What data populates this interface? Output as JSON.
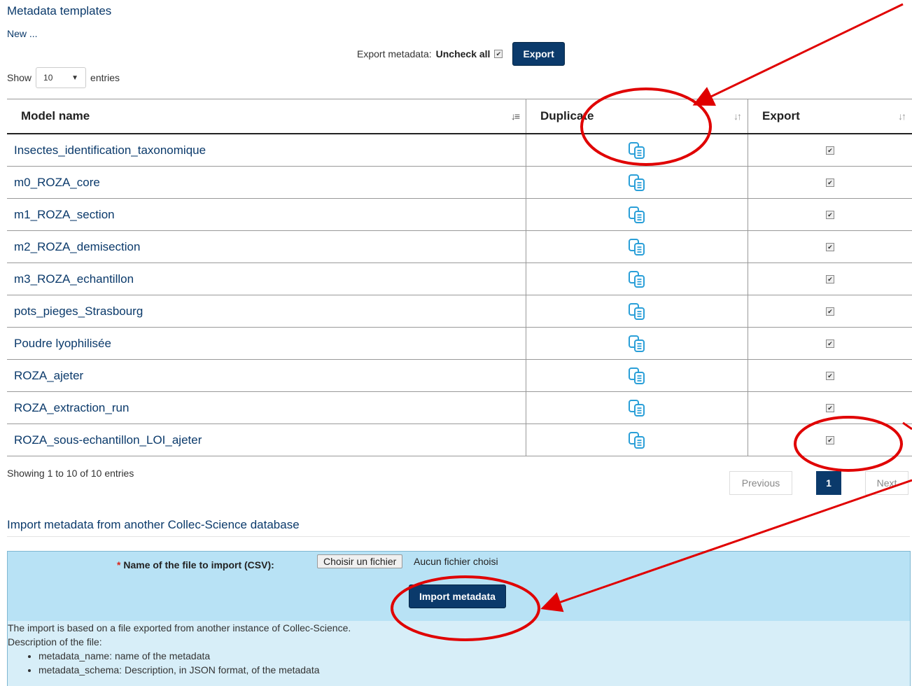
{
  "page": {
    "title": "Metadata templates",
    "new_link": "New ..."
  },
  "export_bar": {
    "label": "Export metadata:",
    "uncheck_all": "Uncheck all",
    "check_mark": "✔",
    "button": "Export"
  },
  "length_menu": {
    "show": "Show",
    "value": "10",
    "entries": "entries"
  },
  "table": {
    "headers": {
      "model_name": "Model name",
      "duplicate": "Duplicate",
      "export": "Export"
    },
    "rows": [
      {
        "name": "Insectes_identification_taxonomique",
        "checked": true
      },
      {
        "name": "m0_ROZA_core",
        "checked": true
      },
      {
        "name": "m1_ROZA_section",
        "checked": true
      },
      {
        "name": "m2_ROZA_demisection",
        "checked": true
      },
      {
        "name": "m3_ROZA_echantillon",
        "checked": true
      },
      {
        "name": "pots_pieges_Strasbourg",
        "checked": true
      },
      {
        "name": "Poudre lyophilisée",
        "checked": true
      },
      {
        "name": "ROZA_ajeter",
        "checked": true
      },
      {
        "name": "ROZA_extraction_run",
        "checked": true
      },
      {
        "name": "ROZA_sous-echantillon_LOI_ajeter",
        "checked": true
      }
    ]
  },
  "info": "Showing 1 to 10 of 10 entries",
  "pagination": {
    "previous": "Previous",
    "current": "1",
    "next": "Next"
  },
  "import": {
    "title": "Import metadata from another Collec-Science database",
    "required_mark": "*",
    "file_label": "Name of the file to import (CSV):",
    "choose_button": "Choisir un fichier",
    "file_status": "Aucun fichier choisi",
    "submit": "Import metadata",
    "note_line1": "The import is based on a file exported from another instance of Collec-Science.",
    "note_line2": "Description of the file:",
    "bullets": [
      "metadata_name: name of the metadata",
      "metadata_schema: Description, in JSON format, of the metadata"
    ]
  },
  "colors": {
    "brand": "#0b3a6b",
    "panel": "#b8e2f5",
    "icon": "#2a9fd8",
    "annotation": "#e00000"
  }
}
